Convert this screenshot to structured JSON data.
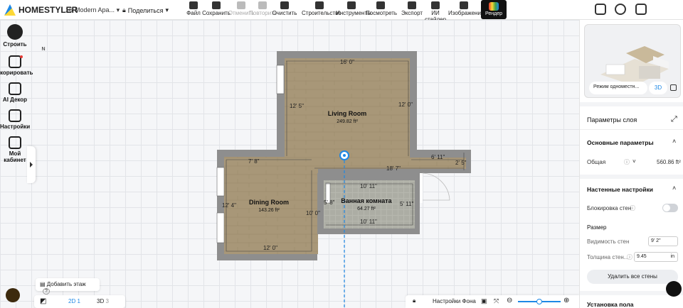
{
  "app": {
    "logo": "HOMESTYLER",
    "project_name": "16-Modern Apa...",
    "share_label": "Поделиться"
  },
  "toolbar": {
    "file": "Файл",
    "save": "Сохранить",
    "undo": "Отменить",
    "redo": "Повторить",
    "clear": "Очистить",
    "build": "Строительство",
    "tools": "Инструменты",
    "view": "Посмотреть",
    "export": "Экспорт",
    "ai_styler": "ИИ стайлер",
    "images": "Изображения",
    "render": "Рендер"
  },
  "left_tools": {
    "build": "Строить",
    "decorate": "корировать",
    "ai_decor": "AI Декор",
    "settings": "Настройки",
    "my_cabinet_line1": "Мой",
    "my_cabinet_line2": "кабинет"
  },
  "compass": "N",
  "plan": {
    "dims": {
      "top": "16' 0\"",
      "living_left": "12' 5\"",
      "living_right": "12' 0\"",
      "dining_top": "7' 8\"",
      "corridor_right": "6' 11\"",
      "corridor_end": "2' 5\"",
      "corridor_long": "18' 7\"",
      "bath_top": "10' 11\"",
      "dining_left": "12' 4\"",
      "bath_left": "5' 8\"",
      "bath_right": "5' 11\"",
      "dining_inner": "10' 0\"",
      "bath_bottom": "10' 11\"",
      "dining_bottom": "12' 0\""
    },
    "rooms": [
      {
        "name": "Living Room",
        "area": "249.82 ft²"
      },
      {
        "name": "Dining Room",
        "area": "143.26 ft²"
      },
      {
        "name": "Ванная комната",
        "area": "64.27 ft²"
      }
    ]
  },
  "bottom": {
    "add_floor": "Добавить этаж",
    "help": "?",
    "view_2d": "2D",
    "view_2d_count": "1",
    "view_3d": "3D",
    "view_3d_count": "3",
    "bg_settings": "Настройки Фона"
  },
  "right_panel": {
    "preview_mode": "Режим одноместн...",
    "preview_3d": "3D",
    "title": "Параметры слоя",
    "basic_params": "Основные параметры",
    "total_label": "Общая",
    "total_value": "560.86 ft²",
    "wall_settings": "Настенные настройки",
    "wall_lock": "Блокировка стен",
    "size": "Размер",
    "wall_visibility": "Видимость стен",
    "wall_visibility_value": "9' 2\"",
    "wall_thickness": "Толщина стен...",
    "wall_thickness_value": "9.45",
    "wall_thickness_unit": "in",
    "delete_walls": "Удалить все стены",
    "floor_setup": "Установка пола"
  },
  "colors": {
    "accent": "#1e88e5",
    "wall": "#8e8e8e",
    "floor_wood": "#a89778",
    "bath_floor": "#aeb0a8"
  }
}
